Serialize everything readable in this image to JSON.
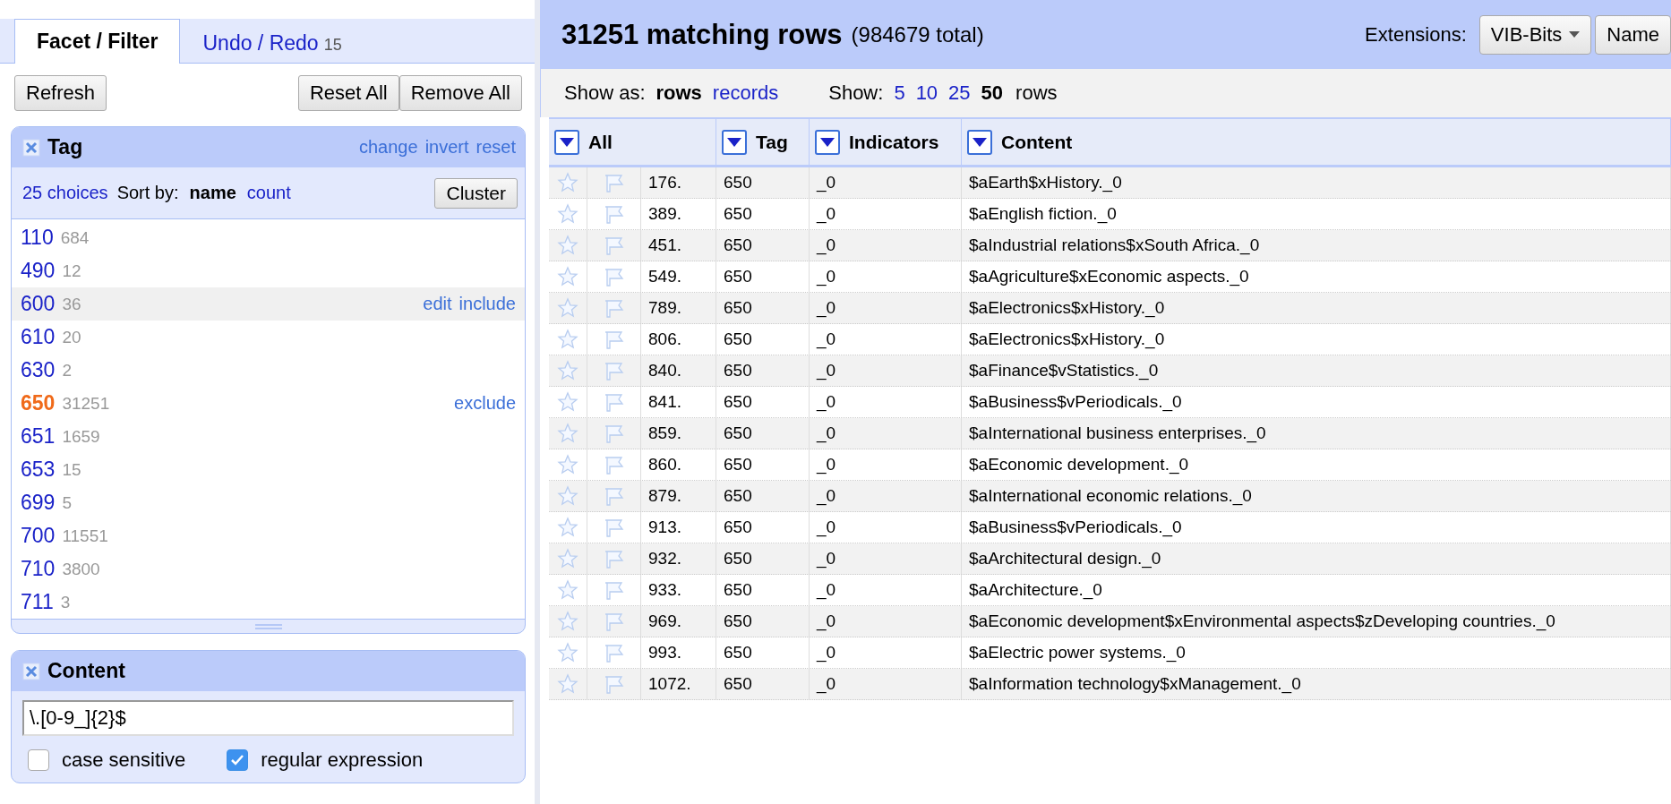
{
  "tabs": [
    {
      "label": "Facet / Filter",
      "selected": true
    },
    {
      "label": "Undo / Redo",
      "count": "15",
      "selected": false
    }
  ],
  "toolbar": {
    "refresh": "Refresh",
    "reset_all": "Reset All",
    "remove_all": "Remove All"
  },
  "tag_facet": {
    "title": "Tag",
    "actions": [
      "change",
      "invert",
      "reset"
    ],
    "choices_count": "25 choices",
    "sort_label": "Sort by:",
    "sort_options": [
      {
        "label": "name",
        "selected": true
      },
      {
        "label": "count",
        "selected": false
      }
    ],
    "cluster": "Cluster",
    "choices": [
      {
        "label": "110",
        "count": "684",
        "selected": false,
        "highlighted": false
      },
      {
        "label": "490",
        "count": "12",
        "selected": false,
        "highlighted": false
      },
      {
        "label": "600",
        "count": "36",
        "selected": false,
        "highlighted": true,
        "actions": [
          "edit",
          "include"
        ]
      },
      {
        "label": "610",
        "count": "20",
        "selected": false,
        "highlighted": false
      },
      {
        "label": "630",
        "count": "2",
        "selected": false,
        "highlighted": false
      },
      {
        "label": "650",
        "count": "31251",
        "selected": true,
        "highlighted": false,
        "actions": [
          "exclude"
        ]
      },
      {
        "label": "651",
        "count": "1659",
        "selected": false,
        "highlighted": false
      },
      {
        "label": "653",
        "count": "15",
        "selected": false,
        "highlighted": false
      },
      {
        "label": "699",
        "count": "5",
        "selected": false,
        "highlighted": false
      },
      {
        "label": "700",
        "count": "11551",
        "selected": false,
        "highlighted": false
      },
      {
        "label": "710",
        "count": "3800",
        "selected": false,
        "highlighted": false
      },
      {
        "label": "711",
        "count": "3",
        "selected": false,
        "highlighted": false
      }
    ]
  },
  "content_facet": {
    "title": "Content",
    "value": "\\.[0-9_]{2}$",
    "options": [
      {
        "label": "case sensitive",
        "checked": false
      },
      {
        "label": "regular expression",
        "checked": true
      }
    ]
  },
  "header": {
    "count": "31251 matching rows",
    "total": "(984679 total)",
    "extensions_label": "Extensions:",
    "extension_button": "VIB-Bits",
    "next_button": "Name"
  },
  "view_bar": {
    "show_as_label": "Show as:",
    "modes": [
      {
        "label": "rows",
        "selected": true
      },
      {
        "label": "records",
        "selected": false
      }
    ],
    "show_label": "Show:",
    "page_sizes": [
      {
        "label": "5",
        "selected": false
      },
      {
        "label": "10",
        "selected": false
      },
      {
        "label": "25",
        "selected": false
      },
      {
        "label": "50",
        "selected": true
      }
    ],
    "unit": "rows"
  },
  "table": {
    "columns": [
      "All",
      "Tag",
      "Indicators",
      "Content"
    ],
    "rows": [
      {
        "num": "176.",
        "tag": "650",
        "ind": "_0",
        "content": "$aEarth$xHistory._0"
      },
      {
        "num": "389.",
        "tag": "650",
        "ind": "_0",
        "content": "$aEnglish fiction._0"
      },
      {
        "num": "451.",
        "tag": "650",
        "ind": "_0",
        "content": "$aIndustrial relations$xSouth Africa._0"
      },
      {
        "num": "549.",
        "tag": "650",
        "ind": "_0",
        "content": "$aAgriculture$xEconomic aspects._0"
      },
      {
        "num": "789.",
        "tag": "650",
        "ind": "_0",
        "content": "$aElectronics$xHistory._0"
      },
      {
        "num": "806.",
        "tag": "650",
        "ind": "_0",
        "content": "$aElectronics$xHistory._0"
      },
      {
        "num": "840.",
        "tag": "650",
        "ind": "_0",
        "content": "$aFinance$vStatistics._0"
      },
      {
        "num": "841.",
        "tag": "650",
        "ind": "_0",
        "content": "$aBusiness$vPeriodicals._0"
      },
      {
        "num": "859.",
        "tag": "650",
        "ind": "_0",
        "content": "$aInternational business enterprises._0"
      },
      {
        "num": "860.",
        "tag": "650",
        "ind": "_0",
        "content": "$aEconomic development._0"
      },
      {
        "num": "879.",
        "tag": "650",
        "ind": "_0",
        "content": "$aInternational economic relations._0"
      },
      {
        "num": "913.",
        "tag": "650",
        "ind": "_0",
        "content": "$aBusiness$vPeriodicals._0"
      },
      {
        "num": "932.",
        "tag": "650",
        "ind": "_0",
        "content": "$aArchitectural design._0"
      },
      {
        "num": "933.",
        "tag": "650",
        "ind": "_0",
        "content": "$aArchitecture._0"
      },
      {
        "num": "969.",
        "tag": "650",
        "ind": "_0",
        "content": "$aEconomic development$xEnvironmental aspects$zDeveloping countries._0"
      },
      {
        "num": "993.",
        "tag": "650",
        "ind": "_0",
        "content": "$aElectric power systems._0"
      },
      {
        "num": "1072.",
        "tag": "650",
        "ind": "_0",
        "content": "$aInformation technology$xManagement._0"
      }
    ]
  }
}
